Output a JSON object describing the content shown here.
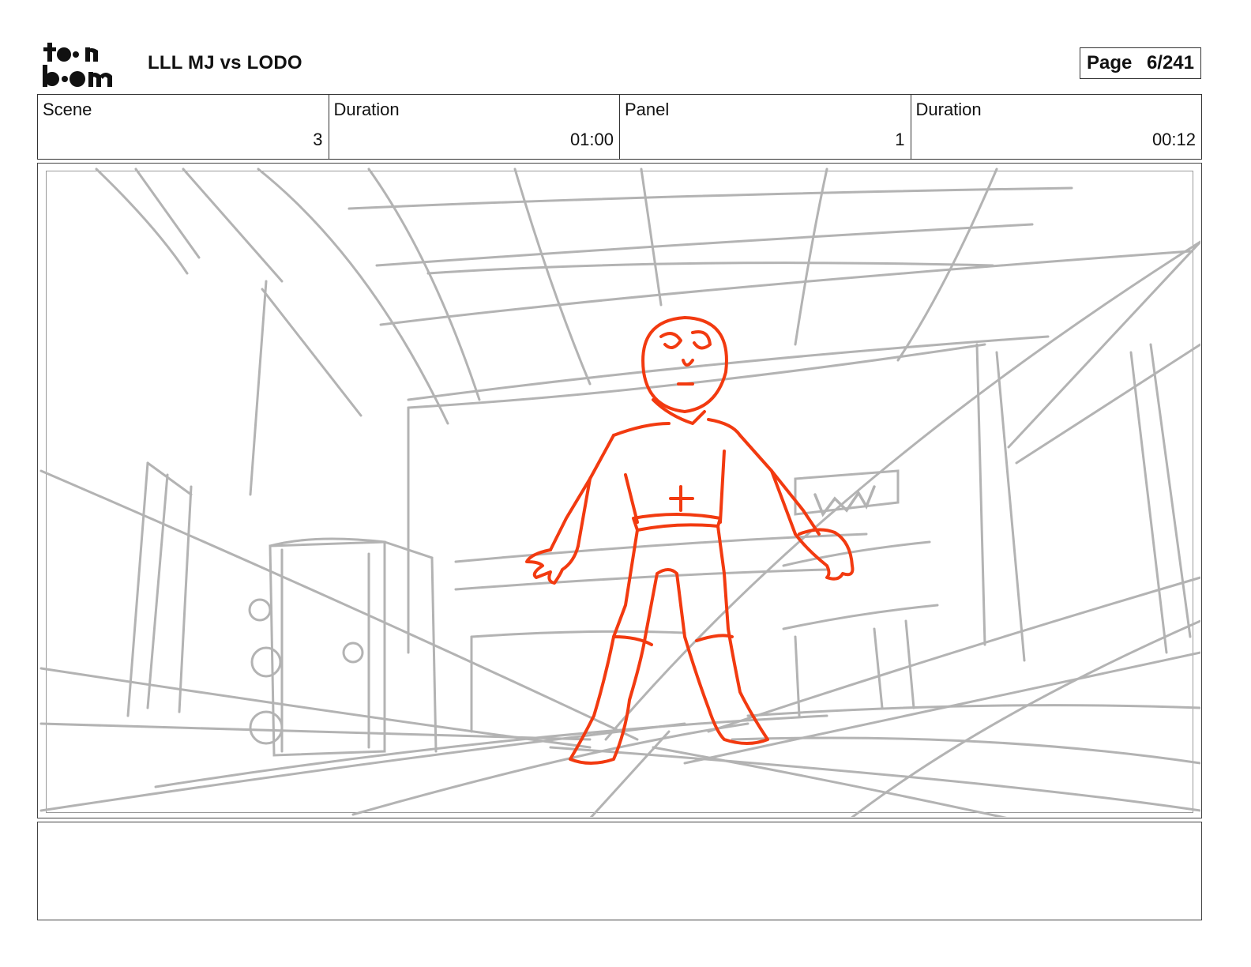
{
  "header": {
    "logo_text": "toon boom",
    "title": "LLL MJ vs LODO",
    "page_label": "Page",
    "page_value": "6/241"
  },
  "info": {
    "scene_label": "Scene",
    "scene_value": "3",
    "scene_duration_label": "Duration",
    "scene_duration_value": "01:00",
    "panel_label": "Panel",
    "panel_value": "1",
    "panel_duration_label": "Duration",
    "panel_duration_value": "00:12"
  },
  "colors": {
    "sketch_gray": "#b3b3b3",
    "character_red": "#f23a10",
    "border": "#333333"
  }
}
